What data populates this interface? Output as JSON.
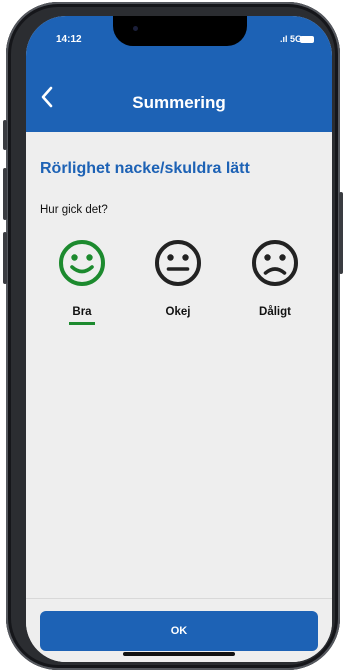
{
  "status_bar": {
    "time": "14:12",
    "network": "5G",
    "signal_icon": "signal-bars-icon",
    "battery_icon": "battery-icon"
  },
  "app_bar": {
    "back_icon": "chevron-left-icon",
    "title": "Summering",
    "color": "#1d62b5"
  },
  "exercise": {
    "title": "Rörlighet nacke/skuldra lätt",
    "title_color": "#1d62b5"
  },
  "question": "Hur gick det?",
  "ratings": [
    {
      "label": "Bra",
      "icon": "smiley-happy-icon",
      "selected": true,
      "color": "#1c8a2e"
    },
    {
      "label": "Okej",
      "icon": "smiley-neutral-icon",
      "selected": false,
      "color": "#222222"
    },
    {
      "label": "Dåligt",
      "icon": "smiley-sad-icon",
      "selected": false,
      "color": "#222222"
    }
  ],
  "ok_button": {
    "label": "OK",
    "color": "#1d62b5"
  }
}
